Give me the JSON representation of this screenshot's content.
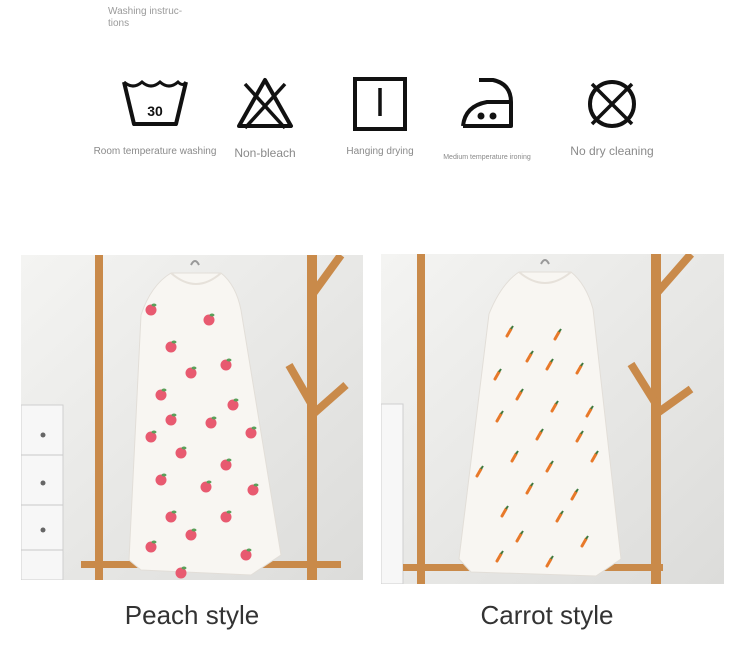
{
  "washing_title": "Washing instruc-\ntions",
  "care_icons": [
    {
      "icon": "wash-30-icon",
      "label": "Room temperature washing",
      "symbol_text": "30"
    },
    {
      "icon": "no-bleach-icon",
      "label": "Non-bleach"
    },
    {
      "icon": "hang-dry-icon",
      "label": "Hanging drying"
    },
    {
      "icon": "iron-medium-icon",
      "label": "Medium temperature ironing"
    },
    {
      "icon": "no-dry-clean-icon",
      "label": "No dry cleaning"
    }
  ],
  "products": [
    {
      "name": "Peach style",
      "pattern": "peach",
      "pattern_color": "#e85a70"
    },
    {
      "name": "Carrot style",
      "pattern": "carrot",
      "pattern_color": "#e8792a"
    }
  ],
  "colors": {
    "rack_wood": "#c98a4a",
    "wall": "#ececec",
    "towel": "#f8f6f2"
  }
}
